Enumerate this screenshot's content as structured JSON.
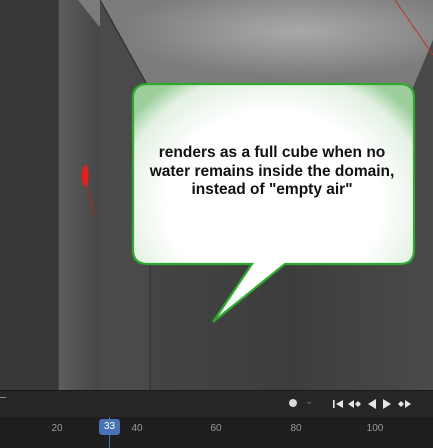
{
  "annotation": {
    "lines": [
      "renders as a full cube when no",
      "water remains inside the domain,",
      "instead of \"empty air\""
    ]
  },
  "colors": {
    "callout_border": "#2fa82f",
    "frame_accent": "#4772b3",
    "red_marker": "#e32020"
  },
  "playback": {
    "record_icon": "record-dot-icon",
    "transport_icons": [
      "jump-to-start-icon",
      "jump-to-keyframe-back-icon",
      "play-reverse-icon",
      "play-icon",
      "jump-to-keyframe-forward-icon"
    ]
  },
  "timeline": {
    "current_frame": "33",
    "ticks": [
      "20",
      "40",
      "60",
      "80",
      "100"
    ]
  }
}
